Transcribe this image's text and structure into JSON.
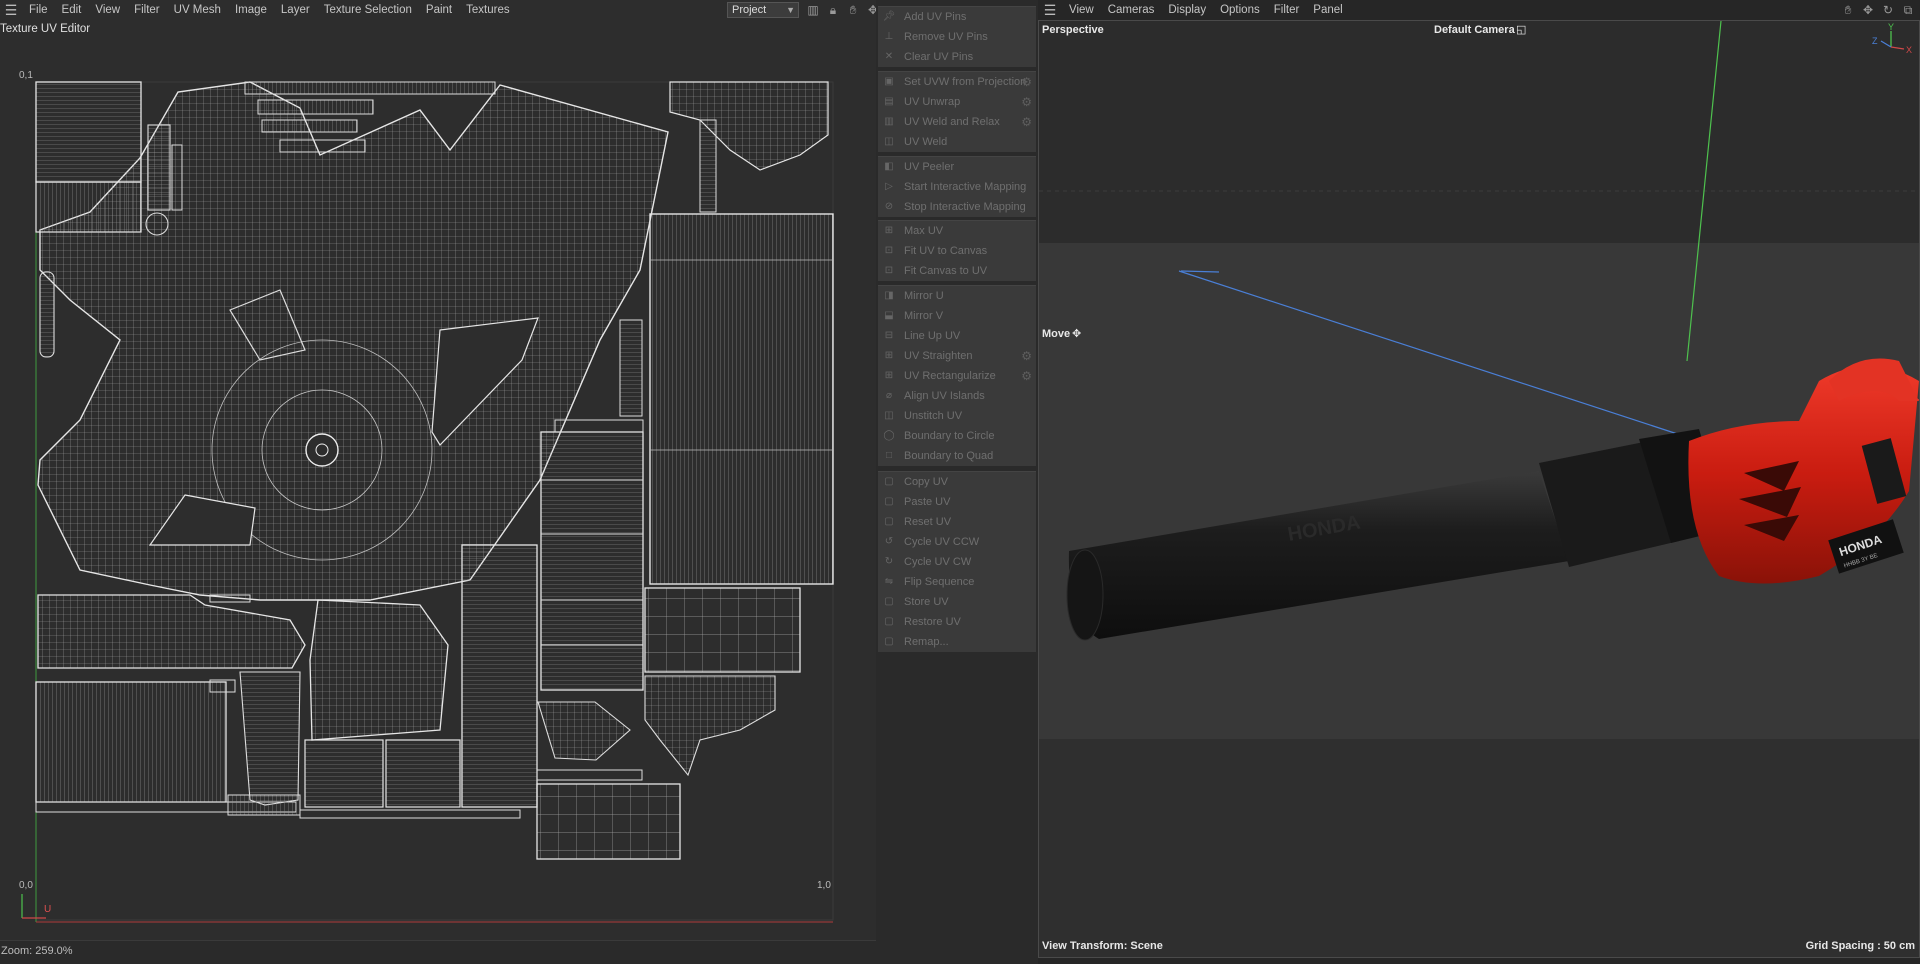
{
  "uv_editor": {
    "menu": [
      "File",
      "Edit",
      "View",
      "Filter",
      "UV Mesh",
      "Image",
      "Layer",
      "Texture Selection",
      "Paint",
      "Textures"
    ],
    "title": "Texture UV Editor",
    "project_select": "Project",
    "corner_top_left": "0,1",
    "corner_bottom_left": "0,0",
    "corner_bottom_right": "1,0",
    "axis_u_label": "U",
    "zoom_text": "Zoom: 259.0%"
  },
  "commands": {
    "groups": [
      [
        {
          "label": "Add UV Pins",
          "icon": "pin-add-icon",
          "gear": false
        },
        {
          "label": "Remove UV Pins",
          "icon": "pin-remove-icon",
          "gear": false
        },
        {
          "label": "Clear UV Pins",
          "icon": "pin-clear-icon",
          "gear": false
        }
      ],
      [
        {
          "label": "Set UVW from Projection",
          "icon": "projection-icon",
          "gear": true
        },
        {
          "label": "UV Unwrap",
          "icon": "unwrap-icon",
          "gear": true
        },
        {
          "label": "UV Weld and Relax",
          "icon": "weld-relax-icon",
          "gear": true
        },
        {
          "label": "UV Weld",
          "icon": "weld-icon",
          "gear": false
        }
      ],
      [
        {
          "label": "UV Peeler",
          "icon": "peeler-icon",
          "gear": false
        },
        {
          "label": "Start Interactive Mapping",
          "icon": "play-icon",
          "gear": false
        },
        {
          "label": "Stop Interactive Mapping",
          "icon": "stop-icon",
          "gear": false
        }
      ],
      [
        {
          "label": "Max UV",
          "icon": "max-uv-icon",
          "gear": false
        },
        {
          "label": "Fit UV to Canvas",
          "icon": "fit-uv-icon",
          "gear": false
        },
        {
          "label": "Fit Canvas to UV",
          "icon": "fit-canvas-icon",
          "gear": false
        }
      ],
      [
        {
          "label": "Mirror U",
          "icon": "mirror-u-icon",
          "gear": false
        },
        {
          "label": "Mirror V",
          "icon": "mirror-v-icon",
          "gear": false
        },
        {
          "label": "Line Up UV",
          "icon": "line-up-icon",
          "gear": false
        },
        {
          "label": "UV Straighten",
          "icon": "straighten-icon",
          "gear": true
        },
        {
          "label": "UV Rectangularize",
          "icon": "rectangularize-icon",
          "gear": true
        },
        {
          "label": "Align UV Islands",
          "icon": "align-icon",
          "gear": false
        },
        {
          "label": "Unstitch UV",
          "icon": "unstitch-icon",
          "gear": false
        },
        {
          "label": "Boundary to Circle",
          "icon": "circle-icon",
          "gear": false
        },
        {
          "label": "Boundary to Quad",
          "icon": "quad-icon",
          "gear": false
        }
      ],
      [
        {
          "label": "Copy UV",
          "icon": "copy-icon",
          "gear": false
        },
        {
          "label": "Paste UV",
          "icon": "paste-icon",
          "gear": false
        },
        {
          "label": "Reset UV",
          "icon": "reset-icon",
          "gear": false
        },
        {
          "label": "Cycle UV CCW",
          "icon": "cycle-ccw-icon",
          "gear": false
        },
        {
          "label": "Cycle UV CW",
          "icon": "cycle-cw-icon",
          "gear": false
        },
        {
          "label": "Flip Sequence",
          "icon": "flip-icon",
          "gear": false
        },
        {
          "label": "Store UV",
          "icon": "store-icon",
          "gear": false
        },
        {
          "label": "Restore UV",
          "icon": "restore-icon",
          "gear": false
        },
        {
          "label": "Remap...",
          "icon": "remap-icon",
          "gear": false
        }
      ]
    ]
  },
  "viewport": {
    "menu": [
      "View",
      "Cameras",
      "Display",
      "Options",
      "Filter",
      "Panel"
    ],
    "name": "Perspective",
    "camera": "Default Camera",
    "tool": "Move",
    "view_transform": "View Transform: Scene",
    "grid_spacing": "Grid Spacing : 50 cm",
    "axis_labels": {
      "x": "X",
      "y": "Y",
      "z": "Z"
    },
    "model_brand": "HONDA",
    "model_code": "HHBB 3Y BE"
  },
  "colors": {
    "axis_x": "#d04848",
    "axis_y": "#4ec24e",
    "axis_z": "#4a7fd6",
    "body_red": "#c91c10"
  }
}
